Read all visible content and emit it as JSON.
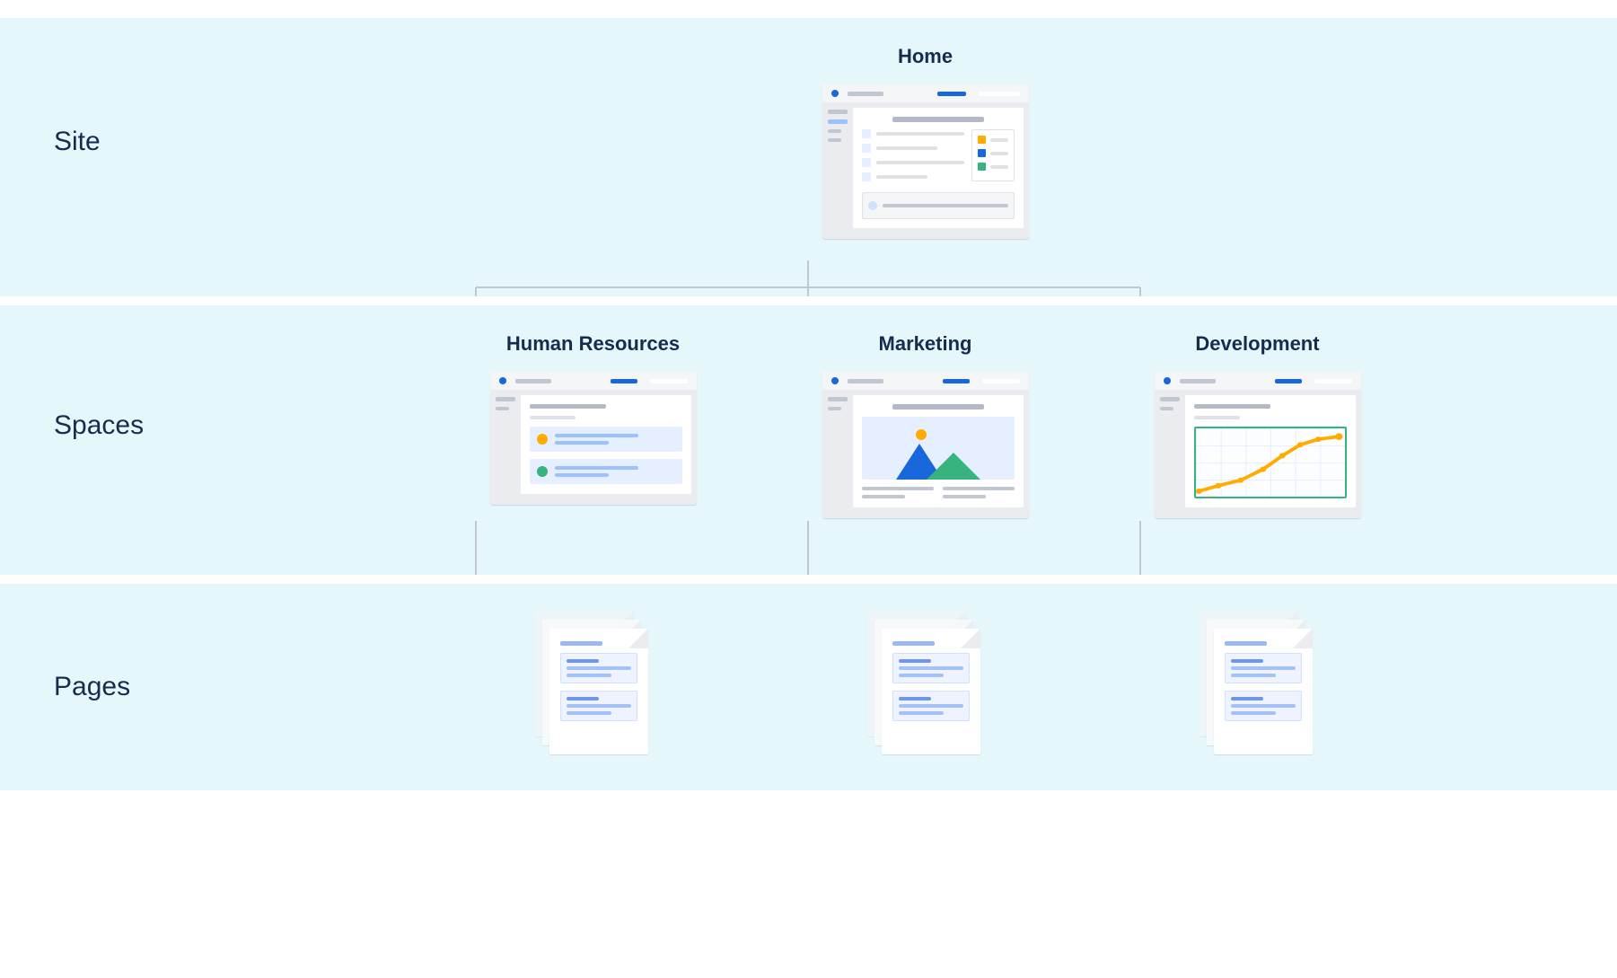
{
  "rows": {
    "site": "Site",
    "spaces": "Spaces",
    "pages": "Pages"
  },
  "site": {
    "home": "Home"
  },
  "spaces": {
    "hr": "Human Resources",
    "marketing": "Marketing",
    "development": "Development"
  },
  "colors": {
    "blue": "#1868db",
    "green": "#36b37e",
    "orange": "#ffab00",
    "navy": "#172b4d"
  }
}
